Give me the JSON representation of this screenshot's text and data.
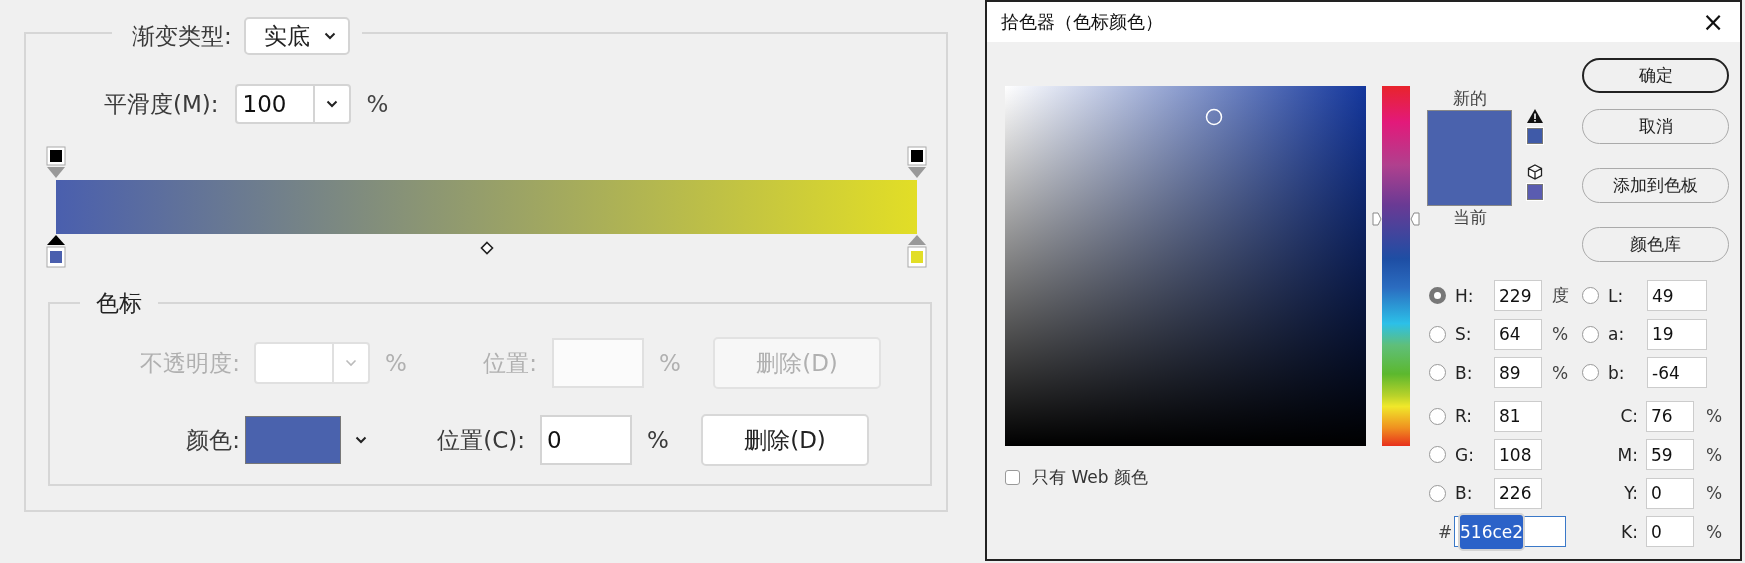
{
  "gradient_editor": {
    "gradient_type": {
      "label": "渐变类型:",
      "value": "实底"
    },
    "smoothness": {
      "label": "平滑度(M):",
      "value": "100",
      "unit": "%"
    },
    "opacity_stops": [
      {
        "selected": false
      },
      {
        "selected": false
      }
    ],
    "color_stops": [
      {
        "color": "#4a5fae",
        "selected": true
      },
      {
        "color": "#e2de26",
        "selected": false
      }
    ],
    "stops_group": {
      "title": "色标",
      "opacity_row": {
        "disabled": true,
        "label": "不透明度:",
        "unit": "%",
        "location_label": "位置:",
        "location_unit": "%",
        "delete": "删除(D)"
      },
      "color_row": {
        "disabled": false,
        "label": "颜色:",
        "color": "#4a62ad",
        "location_label": "位置(C):",
        "location_value": "0",
        "location_unit": "%",
        "delete": "删除(D)"
      }
    }
  },
  "color_picker": {
    "title": "拾色器（色标颜色）",
    "close": "×",
    "hue_slider": {
      "level": 0.63
    },
    "new_swatch": {
      "label": "新的",
      "color": "#4a62ad"
    },
    "current_swatch": {
      "label": "当前",
      "color": "#4a62ad"
    },
    "gamut_warning_swatch": {
      "color": "#3f5aa8"
    },
    "web_safe_swatch": {
      "color": "#5a5cb0"
    },
    "buttons": [
      {
        "label": "确定",
        "default": true
      },
      {
        "label": "取消",
        "default": false
      },
      {
        "label": "添加到色板",
        "default": false
      },
      {
        "label": "颜色库",
        "default": false
      }
    ],
    "web_only": {
      "label": "只有 Web 颜色",
      "checked": false
    },
    "hsb_rgb": [
      {
        "label": "H:",
        "value": "229",
        "unit": "度",
        "selected": true
      },
      {
        "label": "S:",
        "value": "64",
        "unit": "%",
        "selected": false
      },
      {
        "label": "B:",
        "value": "89",
        "unit": "%",
        "selected": false
      },
      {
        "label": "R:",
        "value": "81",
        "selected": false
      },
      {
        "label": "G:",
        "value": "108",
        "selected": false
      },
      {
        "label": "B:",
        "value": "226",
        "selected": false
      }
    ],
    "hex": {
      "label": "#",
      "value": "516ce2",
      "highlighted": true
    },
    "lab": [
      {
        "label": "L:",
        "value": "49",
        "selected": false
      },
      {
        "label": "a:",
        "value": "19",
        "selected": false
      },
      {
        "label": "b:",
        "value": "-64",
        "selected": false
      }
    ],
    "cmyk": [
      {
        "label": "C:",
        "value": "76",
        "unit": "%"
      },
      {
        "label": "M:",
        "value": "59",
        "unit": "%"
      },
      {
        "label": "Y:",
        "value": "0",
        "unit": "%"
      },
      {
        "label": "K:",
        "value": "0",
        "unit": "%"
      }
    ]
  }
}
